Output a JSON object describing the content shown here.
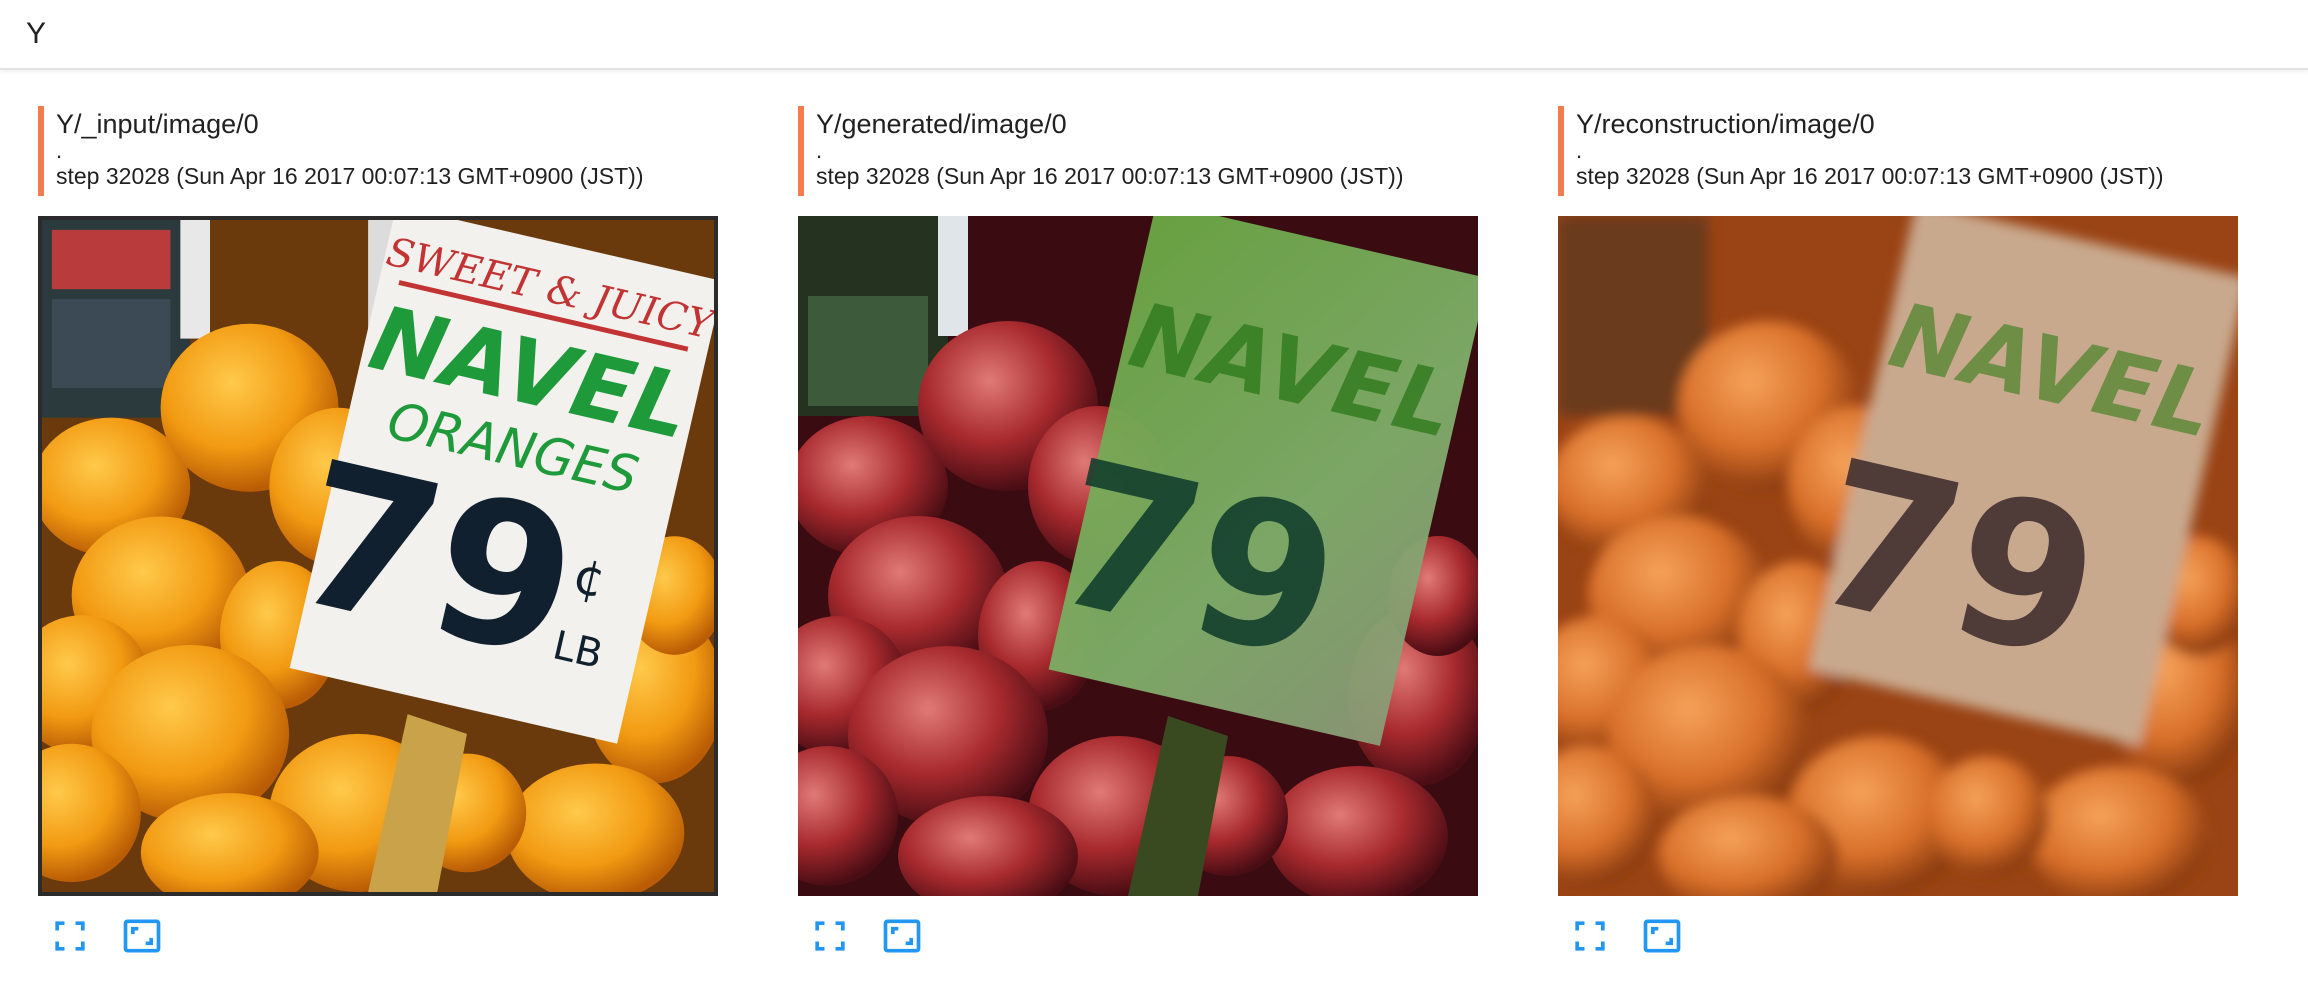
{
  "group": {
    "title": "Y"
  },
  "colors": {
    "accent": "#f57c4d",
    "icon": "#2196f3"
  },
  "cards": [
    {
      "title": "Y/_input/image/0",
      "dot": ".",
      "step": "step 32028 (Sun Apr 16 2017 00:07:13 GMT+0900 (JST))"
    },
    {
      "title": "Y/generated/image/0",
      "dot": ".",
      "step": "step 32028 (Sun Apr 16 2017 00:07:13 GMT+0900 (JST))"
    },
    {
      "title": "Y/reconstruction/image/0",
      "dot": ".",
      "step": "step 32028 (Sun Apr 16 2017 00:07:13 GMT+0900 (JST))"
    }
  ],
  "images": {
    "input": {
      "sign_top": "SWEET & JUICY",
      "sign_main": "NAVEL",
      "sign_sub": "ORANGES",
      "price": "79",
      "unit_cents": "¢",
      "unit_lb": "LB"
    },
    "generated": {
      "sign_main": "NAVEL",
      "price": "79"
    },
    "reconstruction": {
      "sign_main": "NAVEL",
      "price": "79"
    }
  },
  "icons": {
    "fullscreen": "fullscreen-icon",
    "actual_size": "actual-size-icon"
  }
}
